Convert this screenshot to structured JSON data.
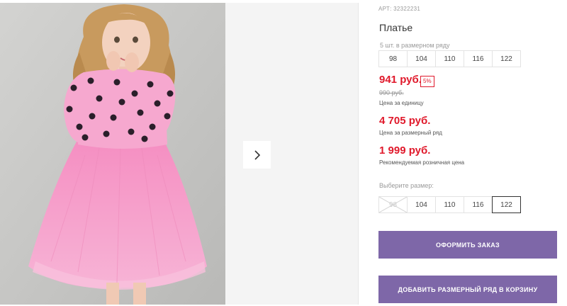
{
  "product": {
    "article": "АРТ: 32322231",
    "title": "Платье"
  },
  "series": {
    "label": "5 шт. в размерном ряду",
    "sizes": [
      "98",
      "104",
      "110",
      "116",
      "122"
    ]
  },
  "prices": {
    "unit_price": "941 руб.",
    "discount_badge": "5%",
    "old_price": "990 руб.",
    "unit_note": "Цена за единицу",
    "series_price": "4 705 руб.",
    "series_note": "Цена за размерный ряд",
    "retail_price": "1 999 руб.",
    "retail_note": "Рекомендуемая розничная цена"
  },
  "size_select": {
    "label": "Выберите размер:",
    "options": [
      {
        "label": "98",
        "state": "unavailable"
      },
      {
        "label": "104",
        "state": "available"
      },
      {
        "label": "110",
        "state": "available"
      },
      {
        "label": "116",
        "state": "available"
      },
      {
        "label": "122",
        "state": "selected"
      }
    ]
  },
  "actions": {
    "order_label": "ОФОРМИТЬ ЗАКАЗ",
    "cart_label": "ДОБАВИТЬ РАЗМЕРНЫЙ РЯД В КОРЗИНУ"
  },
  "colors": {
    "price_red": "#e0192b",
    "button_purple": "#7e67a8",
    "dress_pink": "#f6a4cc"
  },
  "icons": {
    "gallery_next": "chevron-right-icon"
  }
}
